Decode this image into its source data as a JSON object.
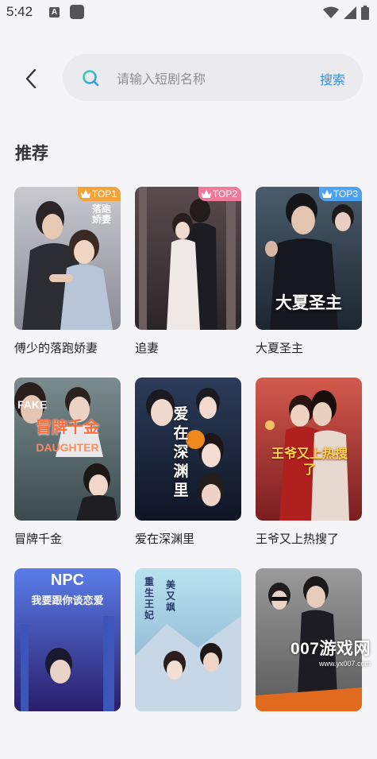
{
  "status_bar": {
    "time": "5:42",
    "a_icon": "A"
  },
  "search": {
    "placeholder": "请输入短剧名称",
    "value": "",
    "button_label": "搜索"
  },
  "section": {
    "title": "推荐"
  },
  "dramas": [
    {
      "title": "傅少的落跑娇妻",
      "badge": "TOP1",
      "poster_text": "落跑娇妻"
    },
    {
      "title": "追妻",
      "badge": "TOP2",
      "poster_text": ""
    },
    {
      "title": "大夏圣主",
      "badge": "TOP3",
      "poster_text": "大夏圣主"
    },
    {
      "title": "冒牌千金",
      "badge": "",
      "poster_text": "冒牌千金",
      "poster_text_2": "FAKE",
      "poster_text_3": "DAUGHTER"
    },
    {
      "title": "爱在深渊里",
      "badge": "",
      "poster_text": "爱在深渊里"
    },
    {
      "title": "王爷又上热搜了",
      "badge": "",
      "poster_text": "王爷又上热搜了"
    },
    {
      "title": "",
      "badge": "",
      "poster_text": "NPC",
      "poster_text_2": "我要跟你谈恋爱"
    },
    {
      "title": "",
      "badge": "",
      "poster_text": "重生王妃",
      "poster_text_2": "美又飒"
    },
    {
      "title": "",
      "badge": "",
      "poster_text": ""
    }
  ],
  "watermark": {
    "main": "007游戏网",
    "url": "www.yx007.com"
  },
  "colors": {
    "accent": "#3a8ee6",
    "top1": "#f2a33a",
    "top2": "#f07a9a",
    "top3": "#4fa2f2"
  }
}
